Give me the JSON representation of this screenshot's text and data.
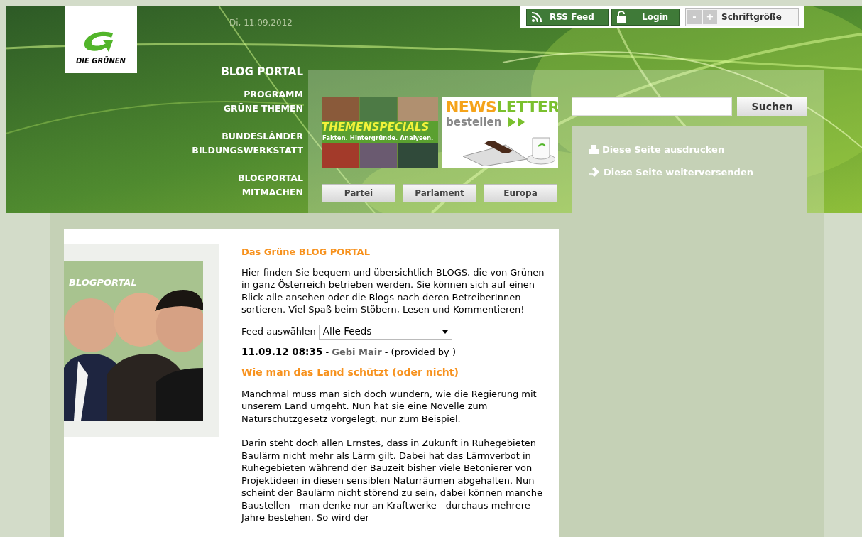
{
  "logo": {
    "text": "DIE GRÜNEN"
  },
  "date": "Di, 11.09.2012",
  "toolbar": {
    "rss": "RSS Feed",
    "login": "Login",
    "font_minus": "-",
    "font_plus": "+",
    "font_size": "Schriftgröße"
  },
  "nav": {
    "title": "BLOG PORTAL",
    "groups": [
      [
        "PROGRAMM",
        "GRÜNE THEMEN"
      ],
      [
        "BUNDESLÄNDER",
        "BILDUNGSWERKSTATT"
      ],
      [
        "BLOGPORTAL",
        "MITMACHEN"
      ]
    ]
  },
  "banners": [
    {
      "kind": "themen",
      "title": "THEMENSPECIALS",
      "subtitle": "Fakten. Hintergründe. Analysen."
    },
    {
      "kind": "newsletter",
      "title_a": "NEWS",
      "title_b": "LETTER",
      "subtitle": "bestellen"
    }
  ],
  "section_buttons": [
    "Partei",
    "Parlament",
    "Europa"
  ],
  "search": {
    "button": "Suchen"
  },
  "page_tools": [
    {
      "kind": "print",
      "label": "Diese Seite ausdrucken"
    },
    {
      "kind": "send",
      "label": "Diese Seite weiterversenden"
    }
  ],
  "sidebar_image": {
    "caption": "BLOGPORTAL"
  },
  "content": {
    "heading": "Das Grüne BLOG PORTAL",
    "intro": "Hier finden Sie bequem und übersichtlich BLOGS, die von Grünen in ganz Österreich betrieben werden. Sie können sich auf einen Blick alle ansehen oder die Blogs nach deren BetreiberInnen sortieren. Viel Spaß beim Stöbern, Lesen und Kommentieren!",
    "feed_label": "Feed auswählen",
    "feed_value": "Alle Feeds",
    "post": {
      "date": "11.09.12 08:35",
      "separator": " - ",
      "author": "Gebi Mair",
      "source": "(provided by )",
      "title": "Wie man das Land schützt (oder nicht)",
      "paragraphs": [
        "Manchmal muss man sich doch wundern, wie die Regierung mit unserem Land umgeht. Nun hat sie eine Novelle zum Naturschutzgesetz vorgelegt, nur zum Beispiel.",
        "Darin steht doch allen Ernstes, dass in Zukunft in Ruhegebieten Baulärm nicht mehr als Lärm gilt. Dabei hat das Lärmverbot in Ruhegebieten während der Bauzeit bisher viele Betonierer von Projektideen in diesen sensiblen Naturräumen abgehalten. Nun scheint der Baulärm nicht störend zu sein, dabei können manche Baustellen - man denke nur an Kraftwerke - durchaus mehrere Jahre bestehen. So wird der"
      ]
    }
  }
}
